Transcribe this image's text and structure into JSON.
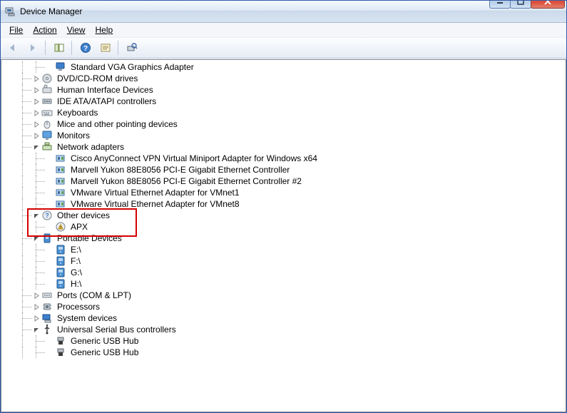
{
  "title": "Device Manager",
  "menu": {
    "file": "File",
    "action": "Action",
    "view": "View",
    "help": "Help"
  },
  "tree": [
    {
      "depth": 3,
      "exp": "none",
      "icon": "display",
      "label": "Standard VGA Graphics Adapter",
      "lines": [
        1,
        1,
        1
      ]
    },
    {
      "depth": 2,
      "exp": "closed",
      "icon": "disc",
      "label": "DVD/CD-ROM drives",
      "lines": [
        1,
        1
      ]
    },
    {
      "depth": 2,
      "exp": "closed",
      "icon": "hid",
      "label": "Human Interface Devices",
      "lines": [
        1,
        1
      ]
    },
    {
      "depth": 2,
      "exp": "closed",
      "icon": "ide",
      "label": "IDE ATA/ATAPI controllers",
      "lines": [
        1,
        1
      ]
    },
    {
      "depth": 2,
      "exp": "closed",
      "icon": "keyboard",
      "label": "Keyboards",
      "lines": [
        1,
        1
      ]
    },
    {
      "depth": 2,
      "exp": "closed",
      "icon": "mouse",
      "label": "Mice and other pointing devices",
      "lines": [
        1,
        1
      ]
    },
    {
      "depth": 2,
      "exp": "closed",
      "icon": "monitor",
      "label": "Monitors",
      "lines": [
        1,
        1
      ]
    },
    {
      "depth": 2,
      "exp": "open",
      "icon": "network",
      "label": "Network adapters",
      "lines": [
        1,
        1
      ]
    },
    {
      "depth": 3,
      "exp": "none",
      "icon": "nic",
      "label": "Cisco AnyConnect VPN Virtual Miniport Adapter for Windows x64",
      "lines": [
        1,
        1,
        1
      ]
    },
    {
      "depth": 3,
      "exp": "none",
      "icon": "nic",
      "label": "Marvell Yukon 88E8056 PCI-E Gigabit Ethernet Controller",
      "lines": [
        1,
        1,
        1
      ]
    },
    {
      "depth": 3,
      "exp": "none",
      "icon": "nic",
      "label": "Marvell Yukon 88E8056 PCI-E Gigabit Ethernet Controller #2",
      "lines": [
        1,
        1,
        1
      ]
    },
    {
      "depth": 3,
      "exp": "none",
      "icon": "nic",
      "label": "VMware Virtual Ethernet Adapter for VMnet1",
      "lines": [
        1,
        1,
        1
      ]
    },
    {
      "depth": 3,
      "exp": "none",
      "icon": "nic",
      "label": "VMware Virtual Ethernet Adapter for VMnet8",
      "lines": [
        1,
        1,
        0
      ],
      "last": true
    },
    {
      "depth": 2,
      "exp": "open",
      "icon": "other",
      "label": "Other devices",
      "lines": [
        1,
        1
      ],
      "hl": "top"
    },
    {
      "depth": 3,
      "exp": "none",
      "icon": "warn",
      "label": "APX",
      "lines": [
        1,
        1,
        0
      ],
      "last": true,
      "hl": "bot"
    },
    {
      "depth": 2,
      "exp": "open",
      "icon": "portable",
      "label": "Portable Devices",
      "lines": [
        1,
        1
      ]
    },
    {
      "depth": 3,
      "exp": "none",
      "icon": "drive",
      "label": "E:\\",
      "lines": [
        1,
        1,
        1
      ]
    },
    {
      "depth": 3,
      "exp": "none",
      "icon": "drive",
      "label": "F:\\",
      "lines": [
        1,
        1,
        1
      ]
    },
    {
      "depth": 3,
      "exp": "none",
      "icon": "drive",
      "label": "G:\\",
      "lines": [
        1,
        1,
        1
      ]
    },
    {
      "depth": 3,
      "exp": "none",
      "icon": "drive",
      "label": "H:\\",
      "lines": [
        1,
        1,
        0
      ],
      "last": true
    },
    {
      "depth": 2,
      "exp": "closed",
      "icon": "ports",
      "label": "Ports (COM & LPT)",
      "lines": [
        1,
        1
      ]
    },
    {
      "depth": 2,
      "exp": "closed",
      "icon": "cpu",
      "label": "Processors",
      "lines": [
        1,
        1
      ]
    },
    {
      "depth": 2,
      "exp": "closed",
      "icon": "system",
      "label": "System devices",
      "lines": [
        1,
        1
      ]
    },
    {
      "depth": 2,
      "exp": "open",
      "icon": "usb",
      "label": "Universal Serial Bus controllers",
      "lines": [
        1,
        0
      ],
      "last": true
    },
    {
      "depth": 3,
      "exp": "none",
      "icon": "usbdev",
      "label": "Generic USB Hub",
      "lines": [
        1,
        0,
        1
      ]
    },
    {
      "depth": 3,
      "exp": "none",
      "icon": "usbdev",
      "label": "Generic USB Hub",
      "lines": [
        1,
        0,
        1
      ]
    }
  ],
  "highlight": {
    "row_start": 13,
    "row_end": 14
  }
}
